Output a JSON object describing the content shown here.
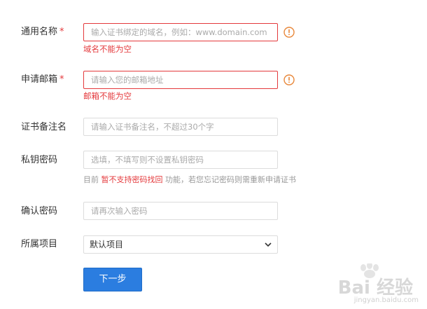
{
  "form": {
    "common_name": {
      "label": "通用名称",
      "required_mark": "*",
      "placeholder": "输入证书绑定的域名，例如：www.domain.com",
      "error": "域名不能为空"
    },
    "email": {
      "label": "申请邮箱",
      "required_mark": "*",
      "placeholder": "请输入您的邮箱地址",
      "error": "邮箱不能为空"
    },
    "note": {
      "label": "证书备注名",
      "placeholder": "请输入证书备注名，不超过30个字"
    },
    "private_key_password": {
      "label": "私钥密码",
      "placeholder": "选填，不填写则不设置私钥密码",
      "hint_prefix": "目前",
      "hint_highlight": "暂不支持密码找回",
      "hint_suffix": "功能，若您忘记密码则需重新申请证书"
    },
    "confirm_password": {
      "label": "确认密码",
      "placeholder": "请再次输入密码"
    },
    "project": {
      "label": "所属项目",
      "selected": "默认项目"
    },
    "next_button": "下一步"
  },
  "watermark": {
    "brand": "Bai 经验",
    "url": "jingyan.baidu.com"
  },
  "colors": {
    "error": "#e4393c",
    "warning_icon": "#e8873a",
    "primary_button": "#2b7de0"
  }
}
